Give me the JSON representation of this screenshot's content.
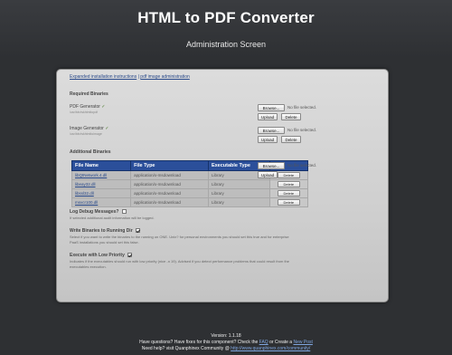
{
  "header": {
    "title": "HTML to PDF Converter",
    "subtitle": "Administration Screen"
  },
  "toplinks": {
    "link1": "Expanded installation instructions",
    "sep": " | ",
    "link2": "pdf image administration"
  },
  "required": {
    "heading": "Required Binaries",
    "pdf_label": "PDF Generator",
    "pdf_check": "✓",
    "pdf_sub": "/usr/bin/wkhtmltopdf",
    "image_label": "Image Generator",
    "image_check": "✓",
    "image_sub": "/usr/bin/wkhtmltoimage",
    "browse_label": "Browse...",
    "nofile_text": "No file selected.",
    "upload_label": "Upload",
    "delete_label": "Delete"
  },
  "additional": {
    "heading": "Additional Binaries",
    "columns": [
      "File Name",
      "File Type",
      "Executable Type"
    ],
    "rows": [
      {
        "name": "libQtNetwork.4.dll",
        "type": "application/x-msdownload",
        "exe": "Library",
        "del": "Delete"
      },
      {
        "name": "libeay32.dll",
        "type": "application/x-msdownload",
        "exe": "Library",
        "del": "Delete"
      },
      {
        "name": "libssl32.dll",
        "type": "application/x-msdownload",
        "exe": "Library",
        "del": "Delete"
      },
      {
        "name": "msvcr100.dll",
        "type": "application/x-msdownload",
        "exe": "Library",
        "del": "Delete"
      }
    ],
    "browse_label": "Browse...",
    "nofile_text": "No file selected.",
    "upload_label": "Upload"
  },
  "options": {
    "debug_label": "Log Debug Messages?",
    "debug_checked": false,
    "debug_desc": "If selected additional audit information will be logged.",
    "binaries_label": "Write Binaries to Running Dir",
    "binaries_checked": true,
    "binaries_desc1": "Select if you want to write the binaries to the running on ONE. Unix? for personal environments you should set this true and for enterprise",
    "binaries_desc2": "PaaS installations you should set this false.",
    "priority_label": "Execute with Low Priority",
    "priority_checked": true,
    "priority_desc1": "Indicates if the executables should run with low priority (nice -n 19). Advised if you detect performance problems that could result from the",
    "priority_desc2": "executables execution."
  },
  "footer": {
    "version": "Version: 1.1.18",
    "line2_pre": "Have questions? Have fixes for this component? Check the ",
    "faq_link": "FAQ",
    "line2_mid": " or Create a ",
    "ticket_link": "New Post",
    "line3_pre": "Need help? visit Quanphinex Community @ ",
    "community_link": "http://www.quanphinex.com/community/"
  }
}
